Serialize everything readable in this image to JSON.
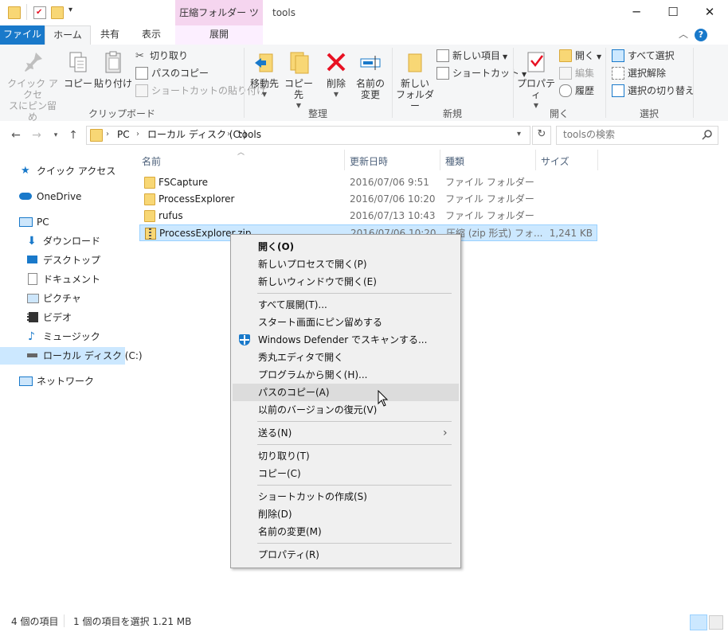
{
  "window": {
    "title": "tools",
    "context_tab_title": "圧縮フォルダー ツール",
    "controls": {
      "minimize": "─",
      "maximize": "☐",
      "close": "✕"
    }
  },
  "ribbon_tabs": [
    {
      "label": "ファイル"
    },
    {
      "label": "ホーム"
    },
    {
      "label": "共有"
    },
    {
      "label": "表示"
    },
    {
      "label": "展開"
    }
  ],
  "ribbon": {
    "clipboard": {
      "group_label": "クリップボード",
      "pin_label_1": "クイック アクセ",
      "pin_label_2": "スにピン留め",
      "copy_label": "コピー",
      "paste_label": "貼り付け",
      "cut_label": "切り取り",
      "copy_path_label": "パスのコピー",
      "paste_shortcut_label": "ショートカットの貼り付け"
    },
    "organize": {
      "group_label": "整理",
      "move_label": "移動先",
      "copy_to_label": "コピー先",
      "delete_label": "削除",
      "rename_label_1": "名前の",
      "rename_label_2": "変更"
    },
    "new": {
      "group_label": "新規",
      "new_folder_label_1": "新しい",
      "new_folder_label_2": "フォルダー",
      "new_item_label": "新しい項目",
      "shortcut_label": "ショートカット"
    },
    "open": {
      "group_label": "開く",
      "properties_label": "プロパティ",
      "open_label": "開く",
      "edit_label": "編集",
      "history_label": "履歴"
    },
    "select": {
      "group_label": "選択",
      "select_all_label": "すべて選択",
      "select_none_label": "選択解除",
      "invert_label": "選択の切り替え"
    }
  },
  "address": {
    "crumbs": [
      "PC",
      "ローカル ディスク (C:)",
      "tools"
    ],
    "search_placeholder": "toolsの検索"
  },
  "nav_pane": [
    {
      "label": "クイック アクセス"
    },
    {
      "label": "OneDrive"
    },
    {
      "label": "PC"
    },
    {
      "label": "ダウンロード"
    },
    {
      "label": "デスクトップ"
    },
    {
      "label": "ドキュメント"
    },
    {
      "label": "ピクチャ"
    },
    {
      "label": "ビデオ"
    },
    {
      "label": "ミュージック"
    },
    {
      "label": "ローカル ディスク (C:)"
    },
    {
      "label": "ネットワーク"
    }
  ],
  "columns": {
    "name": "名前",
    "modified": "更新日時",
    "type": "種類",
    "size": "サイズ"
  },
  "files": [
    {
      "name": "FSCapture",
      "modified": "2016/07/06 9:51",
      "type": "ファイル フォルダー",
      "size": ""
    },
    {
      "name": "ProcessExplorer",
      "modified": "2016/07/06 10:20",
      "type": "ファイル フォルダー",
      "size": ""
    },
    {
      "name": "rufus",
      "modified": "2016/07/13 10:43",
      "type": "ファイル フォルダー",
      "size": ""
    },
    {
      "name": "ProcessExplorer.zip",
      "modified": "2016/07/06 10:20",
      "type": "圧縮 (zip 形式) フォ...",
      "size": "1,241 KB"
    }
  ],
  "status": {
    "items": "4 個の項目",
    "selected": "1 個の項目を選択  1.21 MB"
  },
  "context_menu": [
    {
      "label": "開く(O)"
    },
    {
      "label": "新しいプロセスで開く(P)"
    },
    {
      "label": "新しいウィンドウで開く(E)"
    },
    {
      "label": "すべて展開(T)..."
    },
    {
      "label": "スタート画面にピン留めする"
    },
    {
      "label": "Windows Defender でスキャンする..."
    },
    {
      "label": "秀丸エディタで開く"
    },
    {
      "label": "プログラムから開く(H)..."
    },
    {
      "label": "パスのコピー(A)"
    },
    {
      "label": "以前のバージョンの復元(V)"
    },
    {
      "label": "送る(N)"
    },
    {
      "label": "切り取り(T)"
    },
    {
      "label": "コピー(C)"
    },
    {
      "label": "ショートカットの作成(S)"
    },
    {
      "label": "削除(D)"
    },
    {
      "label": "名前の変更(M)"
    },
    {
      "label": "プロパティ(R)"
    }
  ],
  "colors": {
    "accent": "#1979ca",
    "selection": "#cce8ff",
    "folder": "#f8d775",
    "delete_red": "#e81123"
  }
}
